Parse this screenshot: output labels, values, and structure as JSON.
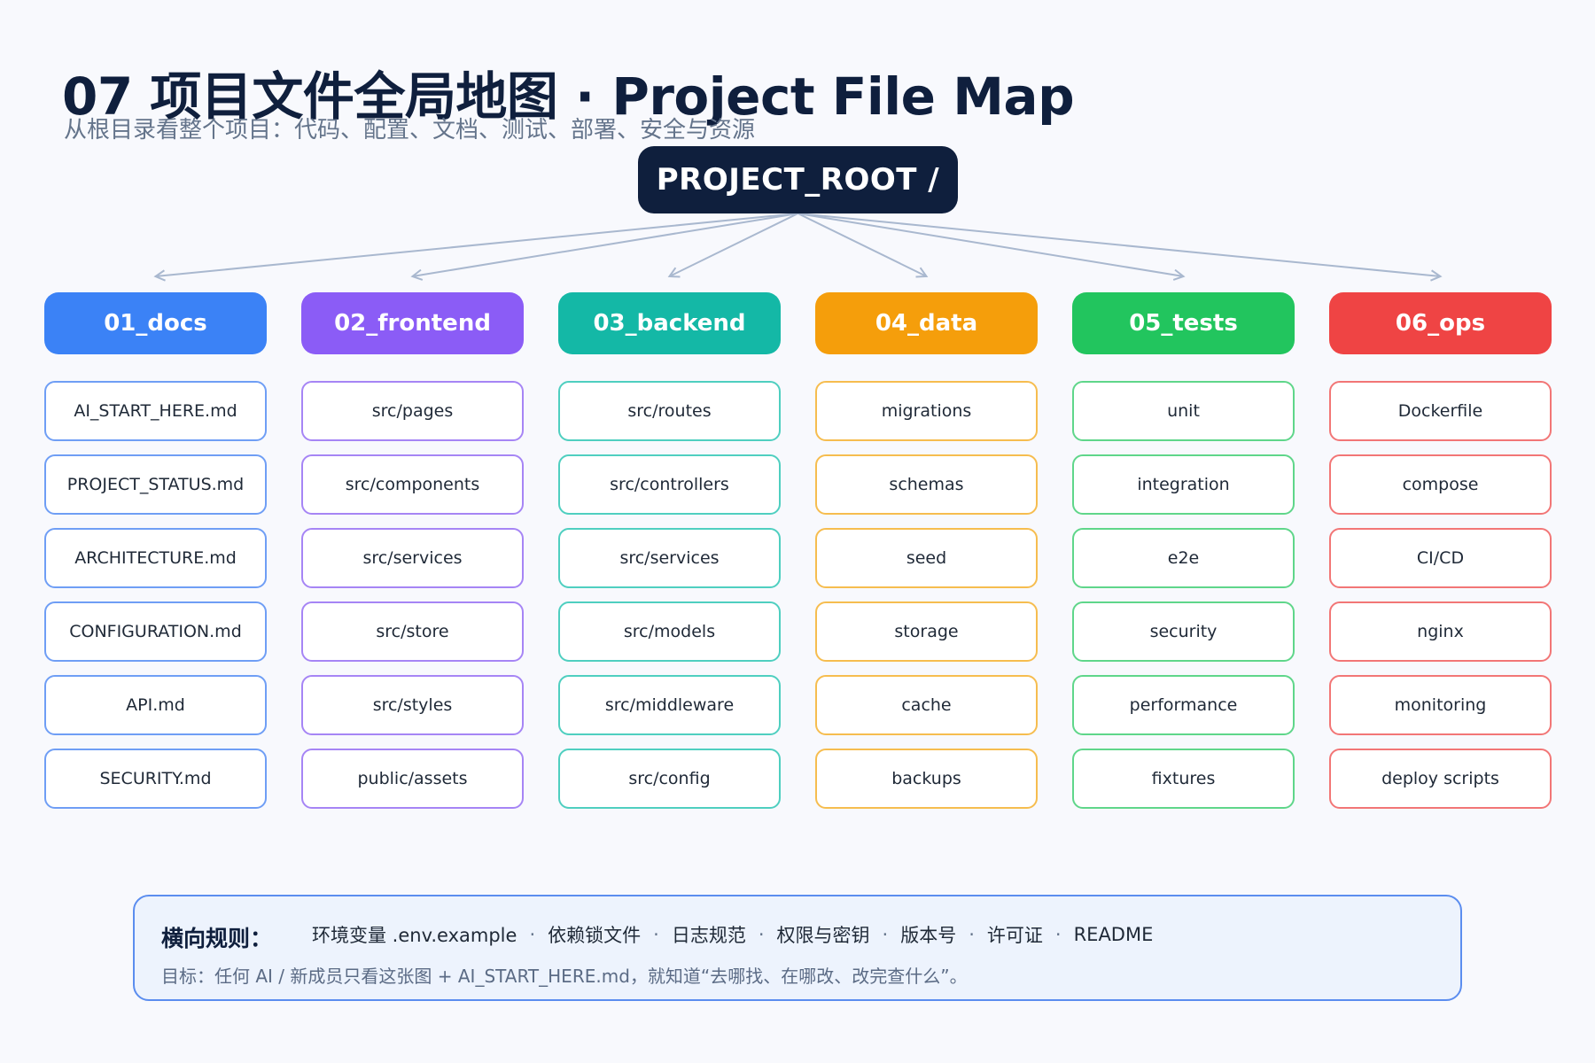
{
  "header": {
    "title": "07 项目文件全局地图 · Project File Map",
    "subtitle": "从根目录看整个项目：代码、配置、文档、测试、部署、安全与资源"
  },
  "root": {
    "label": "PROJECT_ROOT /"
  },
  "columns": [
    {
      "label": "01_docs",
      "color": "#3b82f6",
      "border": "#6f9ef5",
      "items": [
        "AI_START_HERE.md",
        "PROJECT_STATUS.md",
        "ARCHITECTURE.md",
        "CONFIGURATION.md",
        "API.md",
        "SECURITY.md"
      ]
    },
    {
      "label": "02_frontend",
      "color": "#8b5cf6",
      "border": "#a685f5",
      "items": [
        "src/pages",
        "src/components",
        "src/services",
        "src/store",
        "src/styles",
        "public/assets"
      ]
    },
    {
      "label": "03_backend",
      "color": "#14b8a6",
      "border": "#4fcfc0",
      "items": [
        "src/routes",
        "src/controllers",
        "src/services",
        "src/models",
        "src/middleware",
        "src/config"
      ]
    },
    {
      "label": "04_data",
      "color": "#f59e0b",
      "border": "#f6bd4f",
      "items": [
        "migrations",
        "schemas",
        "seed",
        "storage",
        "cache",
        "backups"
      ]
    },
    {
      "label": "05_tests",
      "color": "#22c55e",
      "border": "#5fd68a",
      "items": [
        "unit",
        "integration",
        "e2e",
        "security",
        "performance",
        "fixtures"
      ]
    },
    {
      "label": "06_ops",
      "color": "#ef4444",
      "border": "#f27676",
      "items": [
        "Dockerfile",
        "compose",
        "CI/CD",
        "nginx",
        "monitoring",
        "deploy scripts"
      ]
    }
  ],
  "rules": {
    "label": "横向规则：",
    "items": [
      "环境变量 .env.example",
      "依赖锁文件",
      "日志规范",
      "权限与密钥",
      "版本号",
      "许可证",
      "README"
    ],
    "separator": "·",
    "goal": "目标：任何 AI / 新成员只看这张图 + AI_START_HERE.md，就知道“去哪找、在哪改、改完查什么”。"
  },
  "colors": {
    "root_bg": "#0f1f3d",
    "connector": "#a9b8cf",
    "rules_border": "#5b8def"
  }
}
